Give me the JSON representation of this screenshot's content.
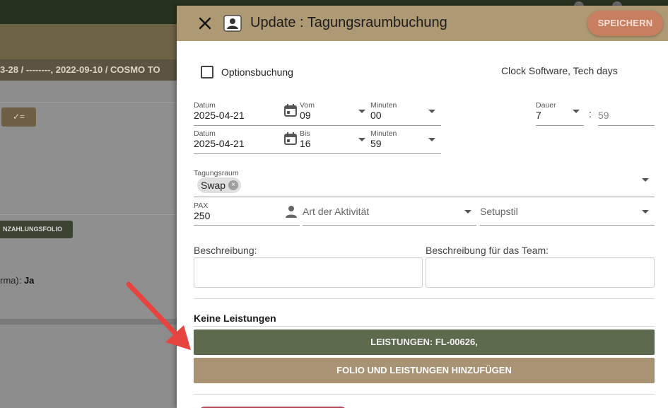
{
  "background": {
    "breadcrumb": "3-28  /  --------, 2022-09-10  /  COSMO TO",
    "folio_button": "NZAHLUNGSFOLIO",
    "field_text_prefix": "rma): ",
    "field_text_value": "Ja",
    "list_icon_glyph": "✓="
  },
  "dialog": {
    "title": "Update : Tagungsraumbuchung",
    "save_label": "SPEICHERN",
    "option_label": "Optionsbuchung",
    "company": "Clock Software, Tech days",
    "row1": {
      "date_label": "Datum",
      "date_value": "2025-04-21",
      "from_label": "Vom",
      "from_value": "09",
      "min_label": "Minuten",
      "min_value": "00"
    },
    "row2": {
      "date_label": "Datum",
      "date_value": "2025-04-21",
      "to_label": "Bis",
      "to_value": "16",
      "min_label": "Minuten",
      "min_value": "59"
    },
    "duration": {
      "label": "Dauer",
      "hours": "7",
      "separator": ":",
      "minutes": "59"
    },
    "room": {
      "label": "Tagungsraum",
      "chip": "Swap"
    },
    "pax": {
      "label": "PAX",
      "value": "250"
    },
    "activity_placeholder": "Art der Aktivität",
    "setup_placeholder": "Setupstil",
    "description_label": "Beschreibung:",
    "team_description_label": "Beschreibung für das Team:",
    "services_title": "Keine Leistungen",
    "services_button": "LEISTUNGEN: FL-00626,",
    "add_folio_button": "FOLIO UND LEISTUNGEN HINZUFÜGEN"
  },
  "colors": {
    "header": "#ad9a74",
    "save_button": "#c77f5f",
    "green_button": "#5e6a4e",
    "tan_button": "#a89374",
    "annotation_arrow": "#e8443f"
  }
}
